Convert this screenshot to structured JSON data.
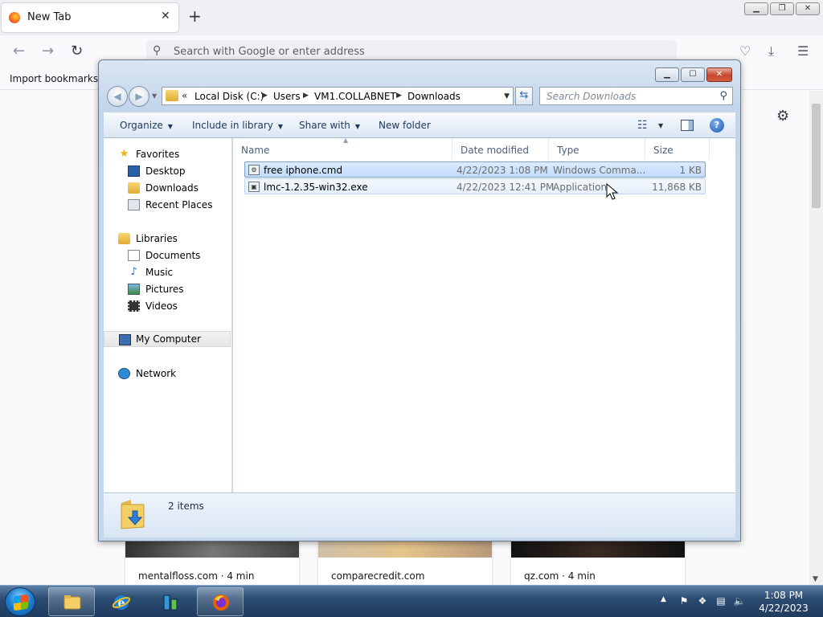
{
  "browser": {
    "tab_title": "New Tab",
    "tab_close": "✕",
    "new_tab": "+",
    "url_placeholder": "Search with Google or enter address",
    "bookmark_import": "Import bookmarks…",
    "settings_icon": "gear-icon",
    "shortcuts": [
      {
        "label": "mentalfloss.com · 4 min"
      },
      {
        "label": "comparecredit.com"
      },
      {
        "label": "qz.com · 4 min"
      }
    ]
  },
  "explorer": {
    "breadcrumb": [
      "Local Disk (C:)",
      "Users",
      "VM1.COLLABNET",
      "Downloads"
    ],
    "breadcrumb_prefix": "«",
    "search_placeholder": "Search Downloads",
    "toolbar": {
      "organize": "Organize",
      "include": "Include in library",
      "share": "Share with",
      "new_folder": "New folder"
    },
    "nav": {
      "favorites": "Favorites",
      "desktop": "Desktop",
      "downloads": "Downloads",
      "recent": "Recent Places",
      "libraries": "Libraries",
      "documents": "Documents",
      "music": "Music",
      "pictures": "Pictures",
      "videos": "Videos",
      "computer": "My Computer",
      "network": "Network"
    },
    "columns": {
      "name": "Name",
      "date": "Date modified",
      "type": "Type",
      "size": "Size"
    },
    "files": [
      {
        "name": "free iphone.cmd",
        "date": "4/22/2023 1:08 PM",
        "type": "Windows Comma...",
        "size": "1 KB"
      },
      {
        "name": "lmc-1.2.35-win32.exe",
        "date": "4/22/2023 12:41 PM",
        "type": "Application",
        "size": "11,868 KB"
      }
    ],
    "item_count": "2 items"
  },
  "taskbar": {
    "time": "1:08 PM",
    "date": "4/22/2023"
  },
  "colors": {
    "accent": "#3c7fb1",
    "selection": "#c1dcfc",
    "taskbar": "#2c4c72"
  }
}
